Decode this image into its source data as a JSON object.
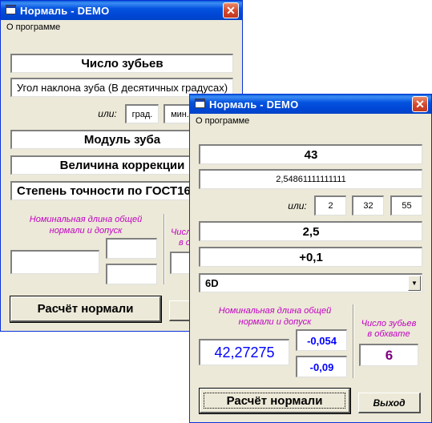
{
  "back_window": {
    "title": "Нормаль - DEMO",
    "menu": "О программе",
    "teeth_count": "Число зубьев",
    "tooth_angle": "Угол наклона зуба (В десятичных градусах)",
    "or_label": "или:",
    "deg_field": "град.",
    "min_field": "мин.",
    "module": "Модуль зуба",
    "correction": "Величина коррекции",
    "accuracy": "Степень точности по ГОСТ164",
    "nominal_length_label": "Номинальная длина общей нормали и допуск",
    "teeth_in_span_label_partial": "Числ",
    "teeth_in_span_label_partial2": "в о",
    "calc_button": "Расчёт нормали",
    "exit_button_partial": "В"
  },
  "front_window": {
    "title": "Нормаль - DEMO",
    "menu": "О программе",
    "teeth_count": "43",
    "tooth_angle": "2,54861111111111",
    "or_label": "или:",
    "degrees": "2",
    "minutes": "32",
    "seconds": "55",
    "module": "2,5",
    "correction": "+0,1",
    "accuracy": "6D",
    "dropdown_icon": "chevron-down-icon",
    "nominal_length_label": "Номинальная длина общей нормали и допуск",
    "teeth_in_span_label": "Число зубьев в обхвате",
    "nominal_length_value": "42,27275",
    "tolerance_upper": "-0,054",
    "tolerance_lower": "-0,09",
    "teeth_in_span_value": "6",
    "calc_button": "Расчёт нормали",
    "exit_button": "Выход"
  },
  "colors": {
    "title_bar": "#0054e3",
    "label_magenta": "#c000c0",
    "result_blue": "#0000ff",
    "result_purple": "#800080",
    "close_red": "#d2472b"
  }
}
